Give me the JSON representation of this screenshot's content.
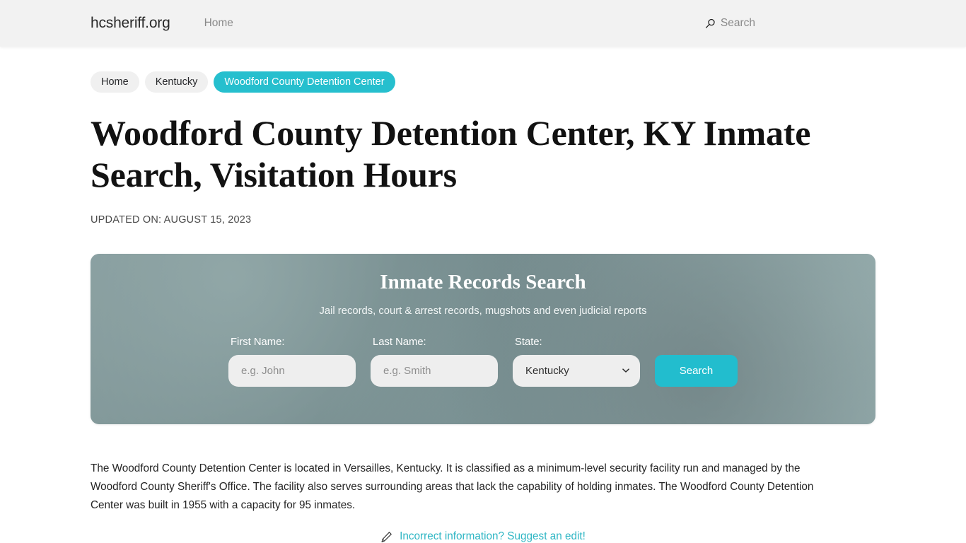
{
  "header": {
    "brand": "hcsheriff.org",
    "nav": [
      {
        "label": "Home"
      }
    ],
    "search": {
      "icon": "search-icon",
      "label": "Search"
    }
  },
  "breadcrumbs": [
    {
      "label": "Home",
      "active": false
    },
    {
      "label": "Kentucky",
      "active": false
    },
    {
      "label": "Woodford County Detention Center",
      "active": true
    }
  ],
  "main": {
    "title": "Woodford County Detention Center, KY Inmate Search, Visitation Hours",
    "updated_on": "UPDATED ON: AUGUST 15, 2023",
    "description": "The Woodford County Detention Center is located in Versailles, Kentucky. It is classified as a minimum-level security facility run and managed by the Woodford County Sheriff's Office. The facility also serves surrounding areas that lack the capability of holding inmates. The Woodford County Detention Center was built in 1955 with a capacity for 95 inmates."
  },
  "search_card": {
    "title": "Inmate Records Search",
    "subtitle": "Jail records, court & arrest records, mugshots and even judicial reports",
    "fields": {
      "first_name": {
        "label": "First Name:",
        "placeholder": "e.g. John",
        "value": ""
      },
      "last_name": {
        "label": "Last Name:",
        "placeholder": "e.g. Smith",
        "value": ""
      },
      "state": {
        "label": "State:",
        "selected": "Kentucky",
        "options": [
          "Kentucky"
        ]
      }
    },
    "submit_label": "Search"
  },
  "suggest_edit": {
    "icon": "pencil-icon",
    "label": "Incorrect information? Suggest an edit!"
  },
  "colors": {
    "accent_teal": "#26bfce",
    "button_teal": "#22bdce",
    "link_teal": "#2eb6c4",
    "header_bg": "#f2f2f2",
    "crumb_bg": "#f0f0f0",
    "input_bg": "#eeeeee",
    "title_color": "#121212"
  }
}
